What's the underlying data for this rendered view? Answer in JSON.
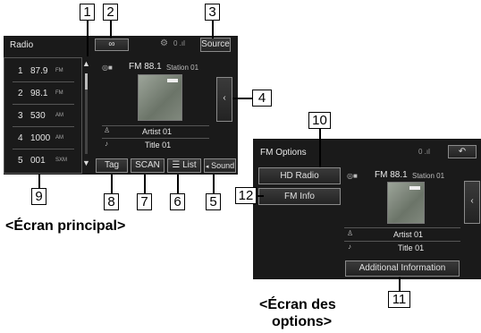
{
  "callouts": [
    "1",
    "2",
    "3",
    "4",
    "5",
    "6",
    "7",
    "8",
    "9",
    "10",
    "11",
    "12"
  ],
  "main_screen": {
    "title": "Radio",
    "source_label": "Source",
    "station": "FM 88.1",
    "station_name": "Station 01",
    "artist": "Artist 01",
    "song_title": "Title 01",
    "presets": [
      {
        "num": "1",
        "freq": "87.9",
        "band": "FM"
      },
      {
        "num": "2",
        "freq": "98.1",
        "band": "FM"
      },
      {
        "num": "3",
        "freq": "530",
        "band": "AM"
      },
      {
        "num": "4",
        "freq": "1000",
        "band": "AM"
      },
      {
        "num": "5",
        "freq": "001",
        "band": "SXM"
      }
    ],
    "buttons": {
      "tag": "Tag",
      "scan": "SCAN",
      "list": "List",
      "sound": "Sound"
    }
  },
  "options_screen": {
    "title": "FM Options",
    "hd_radio": "HD Radio",
    "fm_info": "FM Info",
    "station": "FM 88.1",
    "station_name": "Station 01",
    "artist": "Artist 01",
    "song_title": "Title 01",
    "additional_info": "Additional Information"
  },
  "captions": {
    "main": "<Écran principal>",
    "options_line1": "<Écran des",
    "options_line2": "options>"
  },
  "icons": [
    "link-icon",
    "gear-icon",
    "signal-icon",
    "up-arrow-icon",
    "down-arrow-icon",
    "chevron-left-icon",
    "list-icon",
    "sound-icon",
    "back-icon",
    "person-icon",
    "music-note-icon"
  ]
}
